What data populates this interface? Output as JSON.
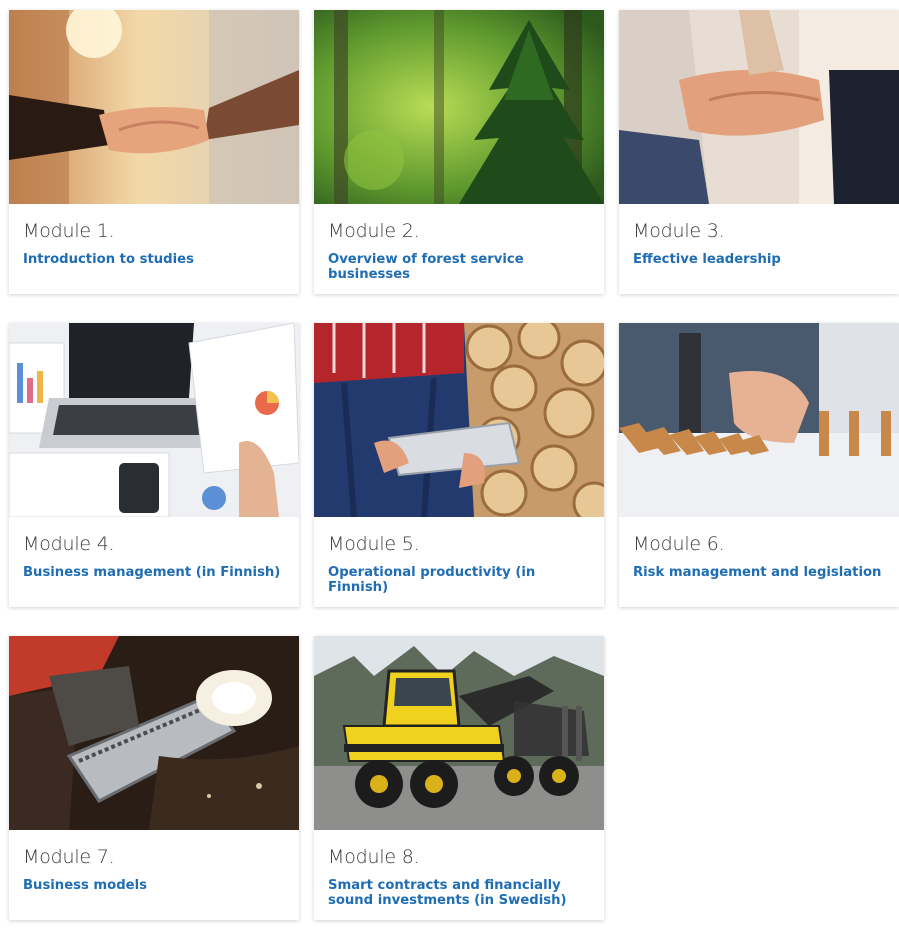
{
  "modules": [
    {
      "number": "Module 1.",
      "title": "Introduction to studies",
      "image": "handshake-photo"
    },
    {
      "number": "Module 2.",
      "title": "Overview of forest service businesses",
      "image": "spruce-forest-photo"
    },
    {
      "number": "Module 3.",
      "title": "Effective leadership",
      "image": "stacked-hands-photo"
    },
    {
      "number": "Module 4.",
      "title": "Business management (in Finnish)",
      "image": "laptop-charts-photo"
    },
    {
      "number": "Module 5.",
      "title": "Operational productivity (in Finnish)",
      "image": "tablet-logs-photo"
    },
    {
      "number": "Module 6.",
      "title": "Risk management and legislation",
      "image": "dominoes-photo"
    },
    {
      "number": "Module 7.",
      "title": "Business models",
      "image": "chainsaw-photo"
    },
    {
      "number": "Module 8.",
      "title": "Smart contracts and financially sound investments (in Swedish)",
      "image": "forwarder-machine-photo"
    }
  ],
  "colors": {
    "title_link": "#1f6db4",
    "module_number": "#3a3a3a"
  }
}
